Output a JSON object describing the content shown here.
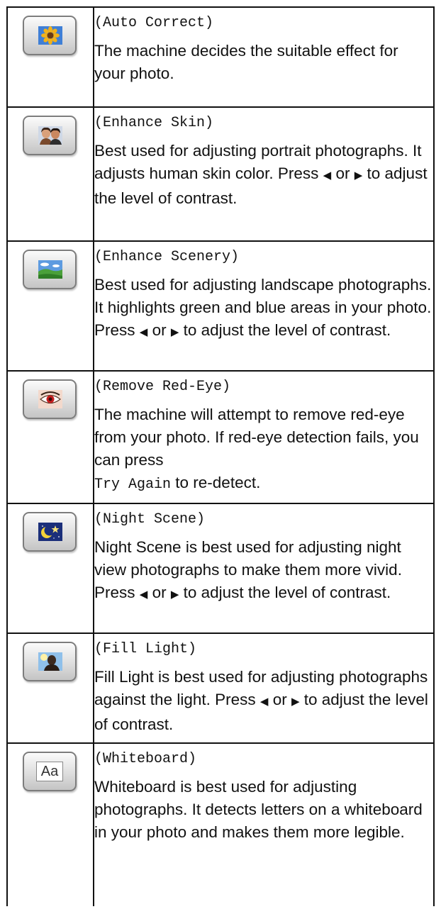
{
  "rows": [
    {
      "mode": "(Auto Correct)",
      "icon": "auto-correct-sunflower-icon",
      "desc": [
        "The machine decides the suitable effect for your photo."
      ]
    },
    {
      "mode": "(Enhance Skin)",
      "icon": "enhance-skin-portrait-icon",
      "desc": [
        "Best used for adjusting portrait photographs. It adjusts human skin color. Press ",
        " or ",
        " to adjust the level of contrast."
      ]
    },
    {
      "mode": "(Enhance Scenery)",
      "icon": "enhance-scenery-landscape-icon",
      "desc": [
        "Best used for adjusting landscape photographs. It highlights green and blue areas in your photo. Press ",
        " or ",
        " to adjust the level of contrast."
      ]
    },
    {
      "mode": "(Remove Red-Eye)",
      "icon": "remove-red-eye-icon",
      "desc": [
        "The machine will attempt to remove red-eye from your photo. If red-eye detection fails, you can press",
        "Try Again",
        " to re-detect."
      ]
    },
    {
      "mode": "(Night Scene)",
      "icon": "night-scene-moon-icon",
      "desc": [
        "Night Scene is best used for adjusting night view photographs to make them more vivid. Press ",
        " or ",
        " to adjust the level of contrast."
      ]
    },
    {
      "mode": "(Fill Light)",
      "icon": "fill-light-backlit-icon",
      "desc": [
        "Fill Light is best used for adjusting photographs against the light. Press ",
        " or ",
        " to adjust the level of contrast."
      ]
    },
    {
      "mode": "(Whiteboard)",
      "icon": "whiteboard-aa-icon",
      "icon_text": "Aa",
      "desc": [
        "Whiteboard is best used for adjusting photographs. It detects letters on a whiteboard in your photo and makes them more legible."
      ]
    }
  ],
  "arrows": {
    "left": "◀",
    "right": "▶"
  },
  "colors": {
    "border": "#111111",
    "button_border": "#7d7d7d",
    "sky": "#3f7fd6",
    "grass": "#4aa03a",
    "night": "#1b2f7a"
  }
}
